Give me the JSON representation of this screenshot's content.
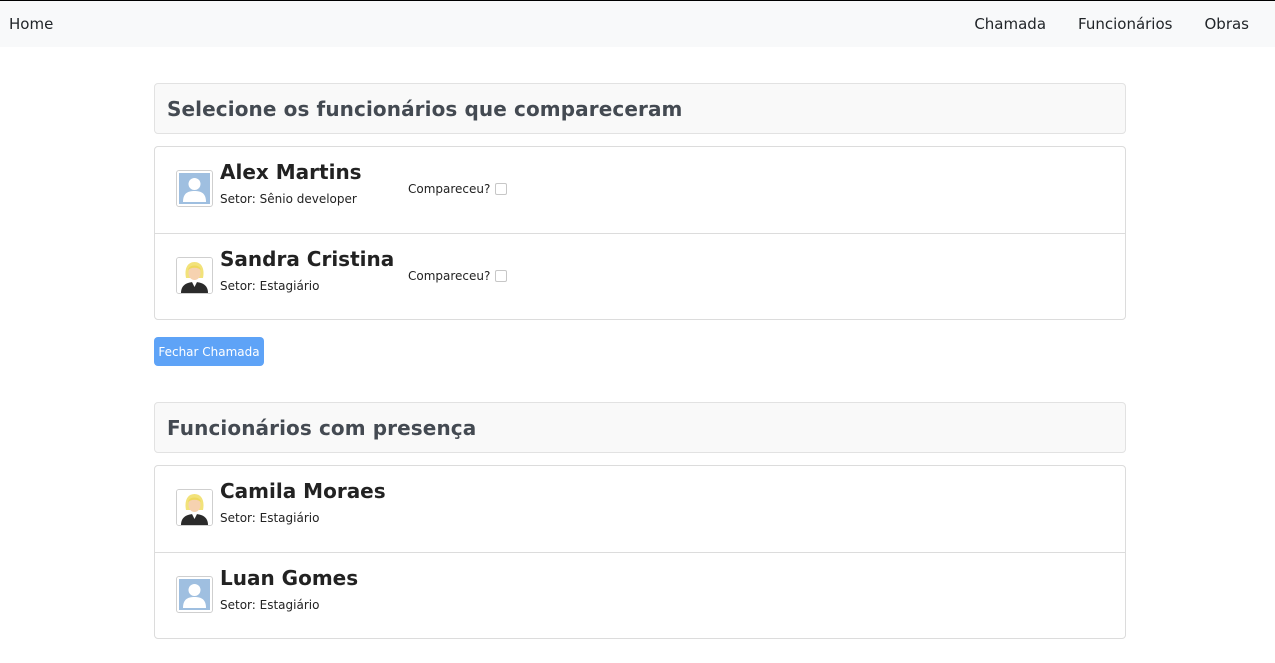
{
  "nav": {
    "home": "Home",
    "links": [
      "Chamada",
      "Funcionários",
      "Obras"
    ]
  },
  "section1": {
    "title": "Selecione os funcionários que compareceram",
    "employees": [
      {
        "name": "Alex Martins",
        "sector": "Setor: Sênio developer",
        "checkbox_label": "Compareceu?",
        "checked": false,
        "avatar": "male-avatar-icon"
      },
      {
        "name": "Sandra Cristina",
        "sector": "Setor: Estagiário",
        "checkbox_label": "Compareceu?",
        "checked": false,
        "avatar": "female-avatar-icon"
      }
    ]
  },
  "close_button": "Fechar Chamada",
  "section2": {
    "title": "Funcionários com presença",
    "employees": [
      {
        "name": "Camila Moraes",
        "sector": "Setor: Estagiário",
        "avatar": "female-avatar-icon"
      },
      {
        "name": "Luan Gomes",
        "sector": "Setor: Estagiário",
        "avatar": "male-avatar-icon"
      }
    ]
  },
  "colors": {
    "primary_button": "#5ea3f7",
    "navbar_bg": "#f8f9fa"
  }
}
